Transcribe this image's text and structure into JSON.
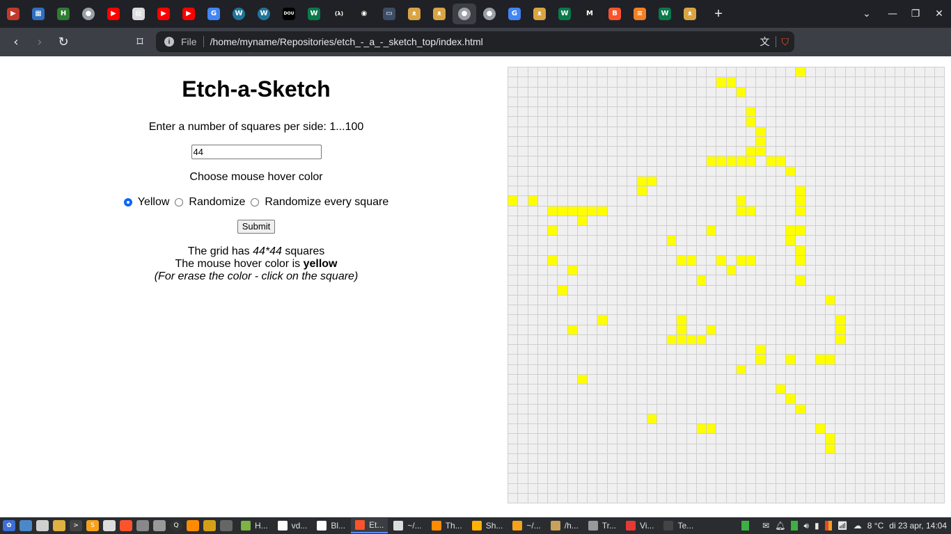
{
  "browser": {
    "tabs": [
      {
        "icon": "bookmark-red-icon",
        "color": "#c0392b"
      },
      {
        "icon": "trello-icon",
        "color": "#2f6fbf"
      },
      {
        "icon": "h-letter-icon",
        "color": "#2e7d32"
      },
      {
        "icon": "globe-icon",
        "color": "#9aa0a6"
      },
      {
        "icon": "youtube-icon",
        "color": "#ff0000"
      },
      {
        "icon": "pdf-doc-icon",
        "color": "#dcdcdc"
      },
      {
        "icon": "youtube-icon",
        "color": "#ff0000"
      },
      {
        "icon": "youtube-icon",
        "color": "#ff0000"
      },
      {
        "icon": "google-translate-icon",
        "color": "#4285f4"
      },
      {
        "icon": "wordpress-icon",
        "color": "#21759b"
      },
      {
        "icon": "wordpress-icon",
        "color": "#21759b"
      },
      {
        "icon": "dou-icon",
        "color": "#000000"
      },
      {
        "icon": "w-green-icon",
        "color": "#0b7a4b"
      },
      {
        "icon": "code-bracket-icon",
        "color": "#202124"
      },
      {
        "icon": "github-icon",
        "color": "#202124"
      },
      {
        "icon": "terminal-icon",
        "color": "#3d4d66"
      },
      {
        "icon": "odin-icon",
        "color": "#d9a441"
      },
      {
        "icon": "odin-icon",
        "color": "#d9a441"
      },
      {
        "icon": "globe-icon",
        "color": "#9aa0a6"
      },
      {
        "icon": "globe-icon",
        "color": "#9aa0a6"
      },
      {
        "icon": "google-translate-icon",
        "color": "#4285f4"
      },
      {
        "icon": "odin-icon",
        "color": "#d9a441"
      },
      {
        "icon": "w-green-icon",
        "color": "#0b7a4b"
      },
      {
        "icon": "m-letter-icon",
        "color": "#202124"
      },
      {
        "icon": "brave-icon",
        "color": "#fb542b"
      },
      {
        "icon": "stackoverflow-icon",
        "color": "#f48024"
      },
      {
        "icon": "w-green-icon",
        "color": "#0b7a4b"
      },
      {
        "icon": "odin-icon",
        "color": "#d9a441"
      }
    ],
    "active_tab_index": 18,
    "new_tab_glyph": "+",
    "address": {
      "scheme": "File",
      "url": "/home/myname/Repositories/etch_-_a_-_sketch_top/index.html"
    }
  },
  "app": {
    "title": "Etch-a-Sketch",
    "prompt": "Enter a number of squares per side: 1...100",
    "input_value": "44",
    "color_prompt": "Choose mouse hover color",
    "radio_options": [
      {
        "label": "Yellow",
        "checked": true
      },
      {
        "label": "Randomize",
        "checked": false
      },
      {
        "label": "Randomize every square",
        "checked": false
      }
    ],
    "submit_label": "Submit",
    "grid_info_prefix": "The grid has ",
    "grid_size_text": "44*44",
    "grid_info_suffix": " squares",
    "hover_prefix": "The mouse hover color is ",
    "hover_color_name": "yellow",
    "erase_hint": "(For erase the color - click on the square)",
    "grid": {
      "size": 44,
      "on_color": "#ffff00",
      "off_color": "#f0f0f0",
      "colored_cells": [
        [
          0,
          29
        ],
        [
          1,
          21
        ],
        [
          1,
          22
        ],
        [
          2,
          23
        ],
        [
          4,
          24
        ],
        [
          5,
          24
        ],
        [
          6,
          25
        ],
        [
          7,
          25
        ],
        [
          8,
          24
        ],
        [
          8,
          25
        ],
        [
          9,
          20
        ],
        [
          9,
          21
        ],
        [
          9,
          22
        ],
        [
          9,
          23
        ],
        [
          9,
          24
        ],
        [
          9,
          26
        ],
        [
          9,
          27
        ],
        [
          10,
          28
        ],
        [
          11,
          13
        ],
        [
          11,
          14
        ],
        [
          12,
          13
        ],
        [
          12,
          29
        ],
        [
          13,
          0
        ],
        [
          13,
          2
        ],
        [
          13,
          23
        ],
        [
          13,
          29
        ],
        [
          14,
          4
        ],
        [
          14,
          5
        ],
        [
          14,
          6
        ],
        [
          14,
          7
        ],
        [
          14,
          8
        ],
        [
          14,
          9
        ],
        [
          14,
          23
        ],
        [
          14,
          24
        ],
        [
          14,
          29
        ],
        [
          15,
          7
        ],
        [
          16,
          4
        ],
        [
          16,
          20
        ],
        [
          16,
          28
        ],
        [
          16,
          29
        ],
        [
          17,
          16
        ],
        [
          17,
          28
        ],
        [
          18,
          29
        ],
        [
          19,
          4
        ],
        [
          19,
          17
        ],
        [
          19,
          18
        ],
        [
          19,
          21
        ],
        [
          19,
          23
        ],
        [
          19,
          24
        ],
        [
          19,
          29
        ],
        [
          20,
          6
        ],
        [
          20,
          22
        ],
        [
          21,
          19
        ],
        [
          21,
          29
        ],
        [
          22,
          5
        ],
        [
          23,
          32
        ],
        [
          25,
          9
        ],
        [
          25,
          17
        ],
        [
          25,
          33
        ],
        [
          26,
          6
        ],
        [
          26,
          17
        ],
        [
          26,
          20
        ],
        [
          26,
          33
        ],
        [
          27,
          16
        ],
        [
          27,
          17
        ],
        [
          27,
          18
        ],
        [
          27,
          19
        ],
        [
          27,
          33
        ],
        [
          28,
          25
        ],
        [
          29,
          25
        ],
        [
          29,
          28
        ],
        [
          29,
          31
        ],
        [
          29,
          32
        ],
        [
          30,
          23
        ],
        [
          31,
          7
        ],
        [
          32,
          27
        ],
        [
          33,
          28
        ],
        [
          34,
          29
        ],
        [
          35,
          14
        ],
        [
          36,
          19
        ],
        [
          36,
          20
        ],
        [
          36,
          31
        ],
        [
          37,
          32
        ],
        [
          38,
          32
        ]
      ]
    }
  },
  "taskbar": {
    "tasks": [
      {
        "label": "H...",
        "color": "#7cb342"
      },
      {
        "label": "vd...",
        "color": "#ffffff"
      },
      {
        "label": "Bl...",
        "color": "#ffffff"
      },
      {
        "label": "Et...",
        "color": "#fb542b",
        "active": true
      },
      {
        "label": "~/...",
        "color": "#dddddd"
      },
      {
        "label": "Th...",
        "color": "#ff8c00"
      },
      {
        "label": "Sh...",
        "color": "#ffb300"
      },
      {
        "label": "~/...",
        "color": "#f7a21b"
      },
      {
        "label": "/h...",
        "color": "#c8a15a"
      },
      {
        "label": "Tr...",
        "color": "#999999"
      },
      {
        "label": "Vi...",
        "color": "#e53935"
      },
      {
        "label": "Te...",
        "color": "#444444"
      }
    ],
    "weather": "8 °C",
    "clock": "di 23 apr, 14:04"
  }
}
